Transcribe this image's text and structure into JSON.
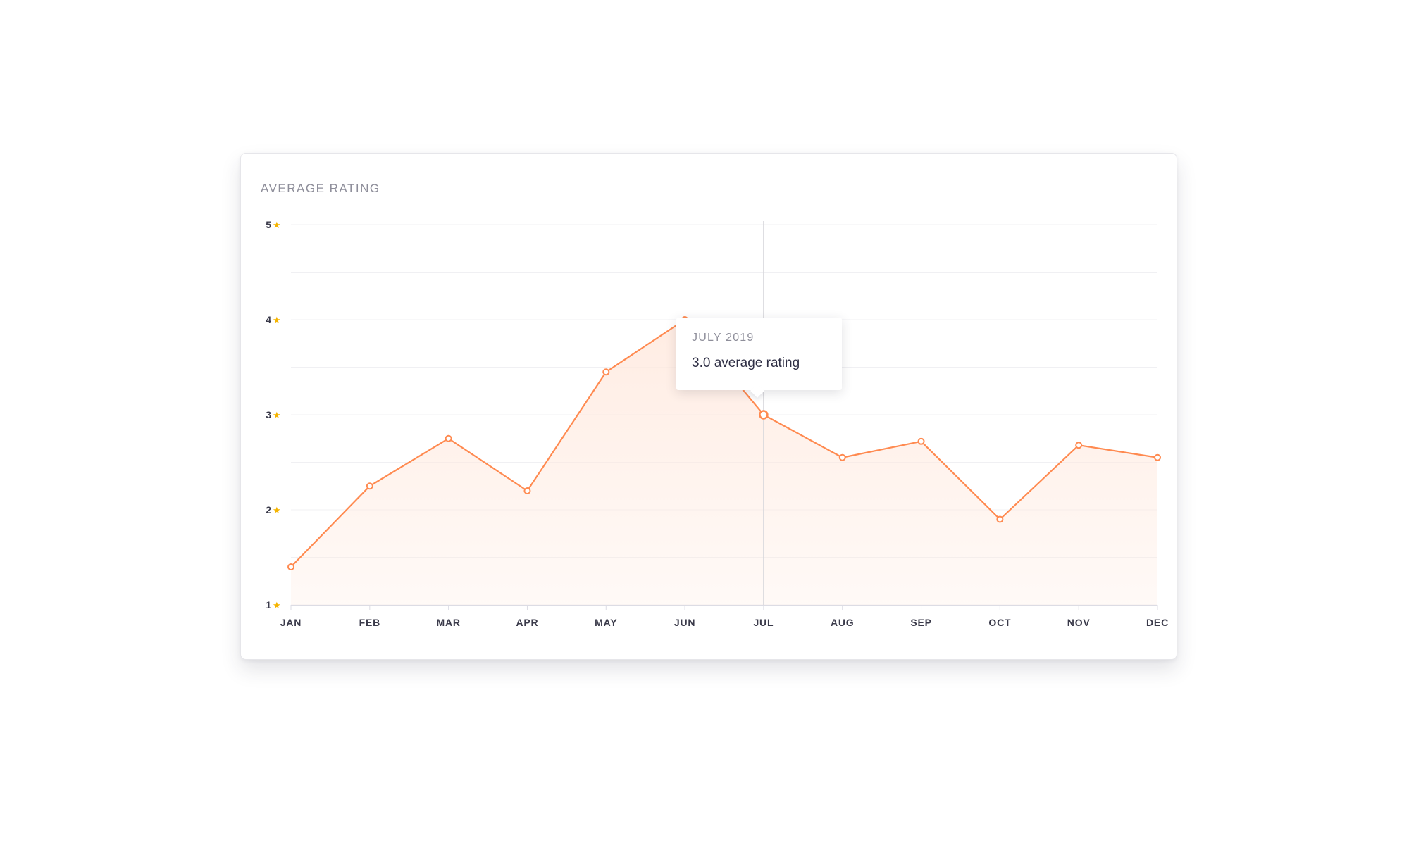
{
  "card": {
    "title": "AVERAGE RATING"
  },
  "tooltip": {
    "date": "JULY 2019",
    "value_text": "3.0 average rating"
  },
  "colors": {
    "line": "#ff8a50",
    "fill": "#ffe9de",
    "star": "#f5b400",
    "axis_text": "#3a3a4a",
    "grid": "#f0f0f3",
    "crosshair": "#d8d8dc"
  },
  "chart_data": {
    "type": "line",
    "title": "AVERAGE RATING",
    "categories": [
      "JAN",
      "FEB",
      "MAR",
      "APR",
      "MAY",
      "JUN",
      "JUL",
      "AUG",
      "SEP",
      "OCT",
      "NOV",
      "DEC"
    ],
    "series": [
      {
        "values": [
          1.4,
          2.25,
          2.75,
          2.2,
          3.45,
          4.0,
          3.0,
          2.55,
          2.72,
          1.9,
          2.68,
          2.55
        ]
      }
    ],
    "ylim": [
      1,
      5
    ],
    "yticks": [
      {
        "value": 1,
        "label": "1"
      },
      {
        "value": 2,
        "label": "2"
      },
      {
        "value": 3,
        "label": "3"
      },
      {
        "value": 4,
        "label": "4"
      },
      {
        "value": 5,
        "label": "5"
      }
    ],
    "ytick_icon": "star-icon",
    "grid": true,
    "highlighted_category": "JUL"
  }
}
